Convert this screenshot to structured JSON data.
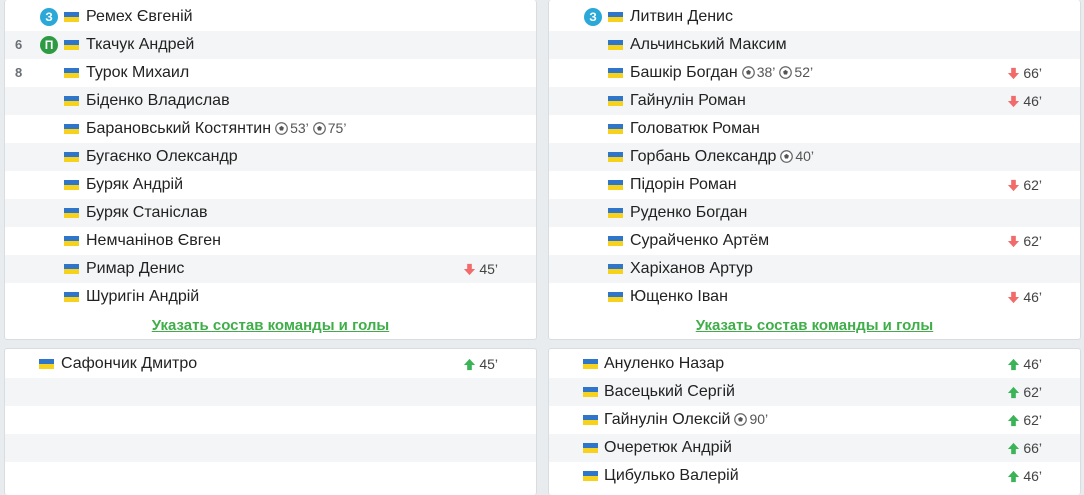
{
  "home": {
    "players": [
      {
        "num": "",
        "badge": "З",
        "badge_color": "blue",
        "name": "Ремех Євгеній"
      },
      {
        "num": "6",
        "badge": "П",
        "badge_color": "green",
        "name": "Ткачук Андрей"
      },
      {
        "num": "8",
        "name": "Турок Михаил"
      },
      {
        "num": "",
        "name": "Біденко Владислав"
      },
      {
        "num": "",
        "name": "Барановський Костянтин",
        "goals": [
          "53’",
          "75’"
        ]
      },
      {
        "num": "",
        "name": "Бугаєнко Олександр"
      },
      {
        "num": "",
        "name": "Буряк Андрій"
      },
      {
        "num": "",
        "name": "Буряк Станіслав"
      },
      {
        "num": "",
        "name": "Немчанінов Євген"
      },
      {
        "num": "",
        "name": "Римар Денис",
        "sub_off": "45’"
      },
      {
        "num": "",
        "name": "Шуригін Андрій"
      }
    ],
    "link": "Указать состав команды и голы",
    "subs": [
      {
        "name": "Сафончик Дмитро",
        "sub_on": "45’"
      }
    ]
  },
  "away": {
    "players": [
      {
        "badge": "З",
        "badge_color": "blue",
        "name": "Литвин Денис"
      },
      {
        "name": "Альчинський Максим"
      },
      {
        "name": "Башкір Богдан",
        "goals": [
          "38’",
          "52’"
        ],
        "sub_off": "66’"
      },
      {
        "name": "Гайнулін Роман",
        "sub_off": "46’"
      },
      {
        "name": "Головатюк Роман"
      },
      {
        "name": "Горбань Олександр",
        "goals": [
          "40’"
        ]
      },
      {
        "name": "Підорін Роман",
        "sub_off": "62’"
      },
      {
        "name": "Руденко Богдан"
      },
      {
        "name": "Сурайченко Артём",
        "sub_off": "62’"
      },
      {
        "name": "Харіханов Артур"
      },
      {
        "name": "Ющенко Іван",
        "sub_off": "46’"
      }
    ],
    "link": "Указать состав команды и голы",
    "subs": [
      {
        "name": "Ануленко Назар",
        "sub_on": "46’"
      },
      {
        "name": "Васецький Сергій",
        "sub_on": "62’"
      },
      {
        "name": "Гайнулін Олексій",
        "goals": [
          "90’"
        ],
        "sub_on": "62’"
      },
      {
        "name": "Очеретюк Андрій",
        "sub_on": "66’"
      },
      {
        "name": "Цибулько Валерій",
        "sub_on": "46’"
      }
    ]
  },
  "colors": {
    "link": "#3fae49",
    "sub_off": "#f26b6b",
    "sub_on": "#3bb357",
    "badge_blue": "#2aa9d8",
    "badge_green": "#2e9b44"
  }
}
